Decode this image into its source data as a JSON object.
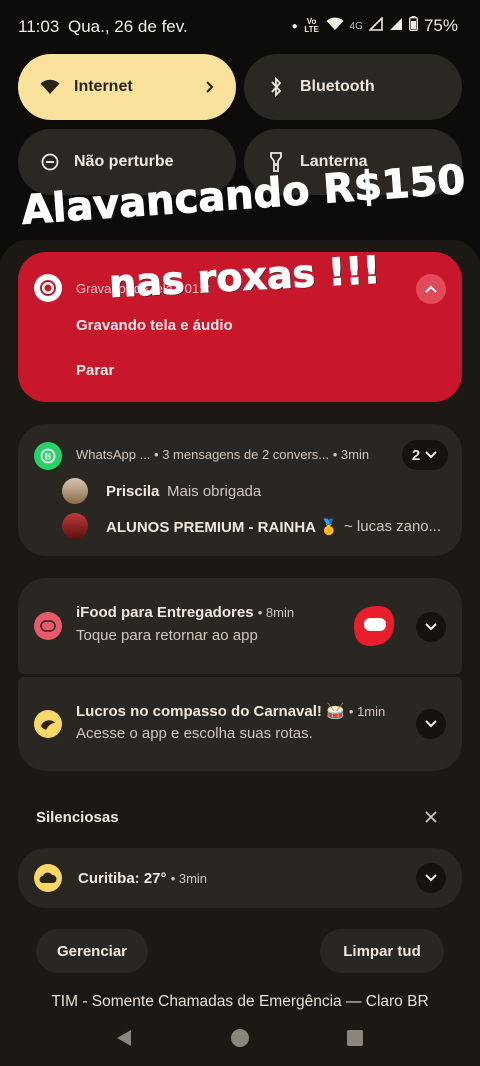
{
  "status": {
    "time": "11:03",
    "date": "Qua., 26 de fev.",
    "battery": "75%",
    "network_label": "4G",
    "volte": "Vo LTE"
  },
  "tiles": [
    {
      "label": "Internet",
      "icon": "wifi-icon",
      "active": true
    },
    {
      "label": "Bluetooth",
      "icon": "bluetooth-icon",
      "active": false
    },
    {
      "label": "Não perturbe",
      "icon": "dnd-icon",
      "active": false
    },
    {
      "label": "Lanterna",
      "icon": "flashlight-icon",
      "active": false
    }
  ],
  "overlay": {
    "line1": "Alavancando R$150",
    "line2": "nas roxas !!!"
  },
  "recorder": {
    "app": "Gravador de tela",
    "time": "01:2",
    "title": "Gravando tela e áudio",
    "action": "Parar",
    "color": "#c8172b"
  },
  "whatsapp": {
    "app": "WhatsApp ...",
    "summary": "• 3 mensagens de 2 convers... • 3min",
    "count": "2",
    "messages": [
      {
        "sender": "Priscila",
        "text": "Mais obrigada"
      },
      {
        "sender": "ALUNOS PREMIUM - RAINHA 🥇",
        "text": "~ lucas zano..."
      }
    ]
  },
  "ifood": {
    "title": "iFood para Entregadores",
    "time": "• 8min",
    "text": "Toque para retornar ao app",
    "brand_color": "#ea1d2c"
  },
  "promo": {
    "title": "Lucros no compasso do Carnaval! 🥁",
    "time": "• 1min",
    "text": "Acesse o app e escolha suas rotas."
  },
  "silent": {
    "header": "Silenciosas",
    "weather_title": "Curitiba: 27°",
    "weather_time": "• 3min"
  },
  "footer": {
    "manage": "Gerenciar",
    "clear": "Limpar tud",
    "carrier": "TIM - Somente Chamadas de Emergência — Claro BR"
  }
}
